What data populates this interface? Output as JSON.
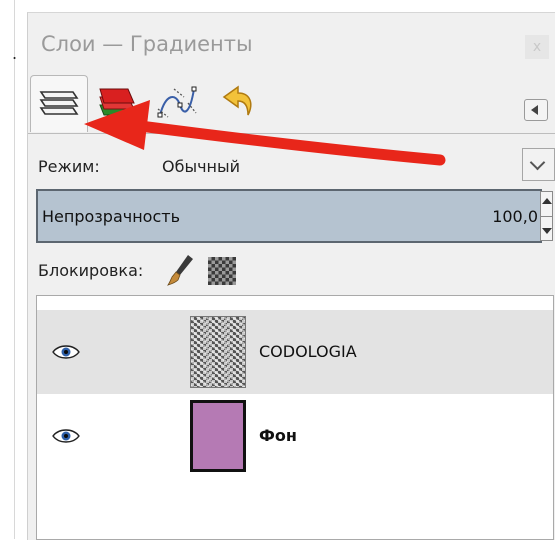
{
  "window": {
    "title": "Слои — Градиенты",
    "close_label": "x",
    "stray_char": "."
  },
  "tabs": [
    {
      "icon": "layers-icon",
      "active": true
    },
    {
      "icon": "channels-icon",
      "active": false
    },
    {
      "icon": "paths-icon",
      "active": false
    },
    {
      "icon": "undo-history-icon",
      "active": false
    }
  ],
  "mode": {
    "label": "Режим:",
    "value": "Обычный"
  },
  "opacity": {
    "label": "Непрозрачность",
    "value": "100,0"
  },
  "lock": {
    "label": "Блокировка:"
  },
  "layers": [
    {
      "name": "CODOLOGIA",
      "visible": true,
      "selected": true,
      "thumb_icon": "transparent-noise-thumbnail"
    },
    {
      "name": "Фон",
      "visible": true,
      "selected": false,
      "thumb_color": "#b57ab4"
    }
  ],
  "colors": {
    "annotation_arrow": "#e8261a",
    "opacity_bar": "#b5c3d0"
  }
}
